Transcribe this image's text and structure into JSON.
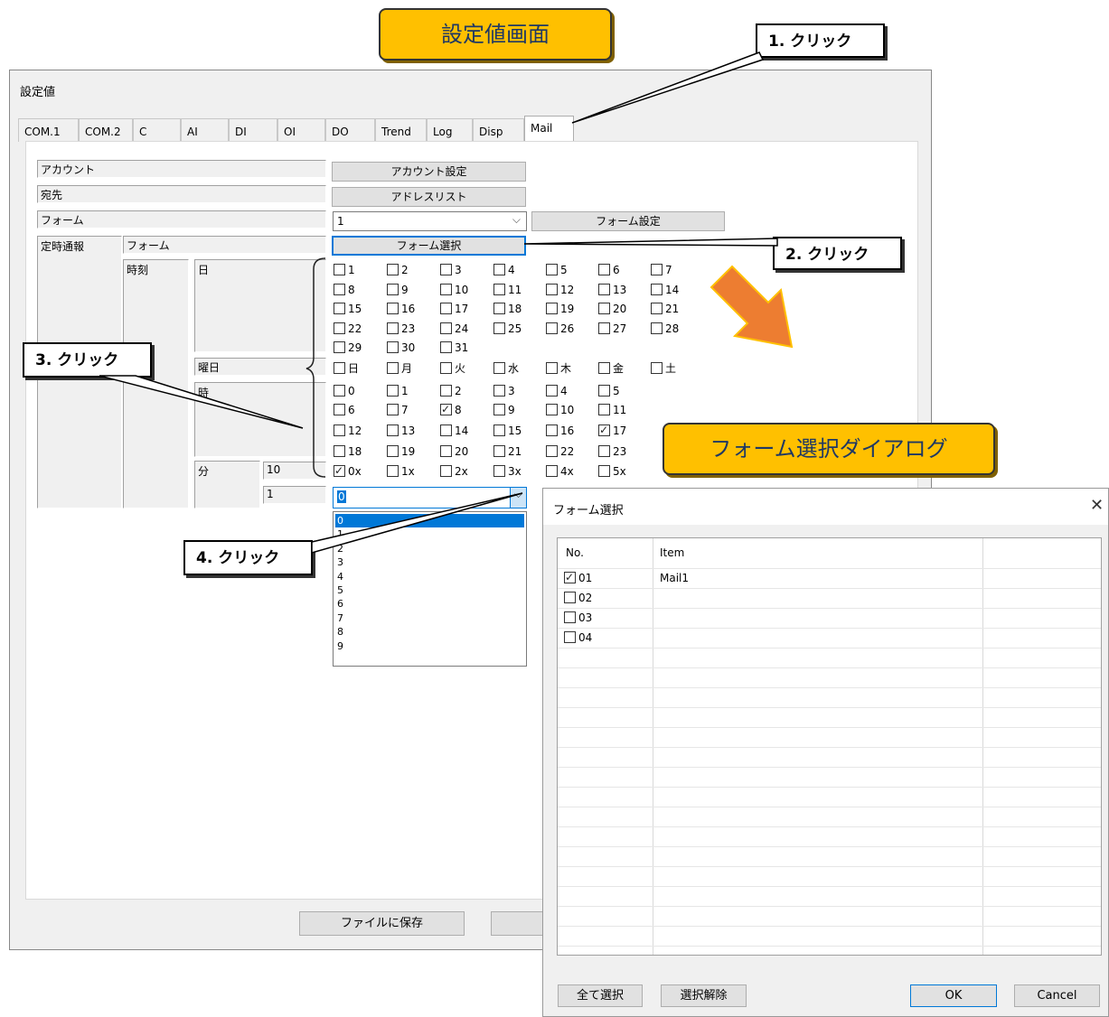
{
  "callouts": {
    "main": "設定値画面",
    "dialog": "フォーム選択ダイアログ"
  },
  "steps": {
    "s1": "1. クリック",
    "s2": "2. クリック",
    "s3": "3. クリック",
    "s4": "4. クリック"
  },
  "window": {
    "title": "設定値"
  },
  "tabs": [
    "COM.1",
    "COM.2",
    "C",
    "AI",
    "DI",
    "OI",
    "DO",
    "Trend",
    "Log",
    "Disp",
    "Mail"
  ],
  "fields": {
    "account": "アカウント",
    "account_btn": "アカウント設定",
    "dest": "宛先",
    "address_btn": "アドレスリスト",
    "form": "フォーム",
    "form_value": "1",
    "form_setting_btn": "フォーム設定",
    "scheduled": "定時通報",
    "form2": "フォーム",
    "form_select_btn": "フォーム選択",
    "time": "時刻",
    "day": "日",
    "weekday": "曜日",
    "hour": "時",
    "minute": "分",
    "minute_val1": "10",
    "minute_val2": "1",
    "minute_combo": "0"
  },
  "days": [
    "1",
    "2",
    "3",
    "4",
    "5",
    "6",
    "7",
    "8",
    "9",
    "10",
    "11",
    "12",
    "13",
    "14",
    "15",
    "16",
    "17",
    "18",
    "19",
    "20",
    "21",
    "22",
    "23",
    "24",
    "25",
    "26",
    "27",
    "28",
    "29",
    "30",
    "31"
  ],
  "weekdays": [
    "日",
    "月",
    "火",
    "水",
    "木",
    "金",
    "土"
  ],
  "hours": [
    "0",
    "1",
    "2",
    "3",
    "4",
    "5",
    "6",
    "7",
    "8",
    "9",
    "10",
    "11",
    "12",
    "13",
    "14",
    "15",
    "16",
    "17",
    "18",
    "19",
    "20",
    "21",
    "22",
    "23"
  ],
  "hours_checked": [
    "8",
    "17"
  ],
  "minutes_tens": [
    "0x",
    "1x",
    "2x",
    "3x",
    "4x",
    "5x"
  ],
  "minutes_checked": [
    "0x"
  ],
  "dropdown": {
    "options": [
      "0",
      "1",
      "2",
      "3",
      "4",
      "5",
      "6",
      "7",
      "8",
      "9"
    ],
    "selected": "0"
  },
  "footer": {
    "save_btn": "ファイルに保存"
  },
  "dialog": {
    "title": "フォーム選択",
    "col_no": "No.",
    "col_item": "Item",
    "rows": [
      {
        "no": "01",
        "item": "Mail1",
        "checked": true
      },
      {
        "no": "02",
        "item": "",
        "checked": false
      },
      {
        "no": "03",
        "item": "",
        "checked": false
      },
      {
        "no": "04",
        "item": "",
        "checked": false
      }
    ],
    "select_all": "全て選択",
    "deselect": "選択解除",
    "ok": "OK",
    "cancel": "Cancel"
  },
  "colors": {
    "callout": "#ffc000",
    "arrow": "#ed7d31",
    "select_blue": "#0078d7"
  }
}
